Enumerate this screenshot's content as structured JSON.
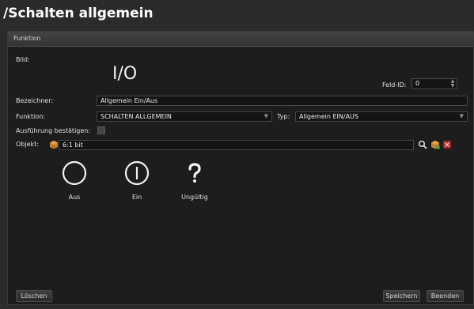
{
  "window": {
    "title": "/Schalten allgemein"
  },
  "panel": {
    "header": "Funktion"
  },
  "form": {
    "bild_label": "Bild:",
    "bild_value": "I/O",
    "feld_id_label": "Feld-ID:",
    "feld_id_value": "0",
    "bezeichner_label": "Bezeichner:",
    "bezeichner_value": "Allgemein Ein/Aus",
    "funktion_label": "Funktion:",
    "funktion_value": "SCHALTEN ALLGEMEIN",
    "typ_label": "Typ:",
    "typ_value": "Allgemein EIN/AUS",
    "confirm_label": "Ausführung bestätigen:",
    "objekt_label": "Objekt:",
    "objekt_value": "6:1 bit"
  },
  "states": [
    {
      "label": "Aus",
      "icon": "circle-off-icon"
    },
    {
      "label": "Ein",
      "icon": "circle-on-icon"
    },
    {
      "label": "Ungültig",
      "icon": "question-mark-icon"
    }
  ],
  "buttons": {
    "delete": "Löschen",
    "save": "Speichern",
    "close": "Beenden"
  }
}
